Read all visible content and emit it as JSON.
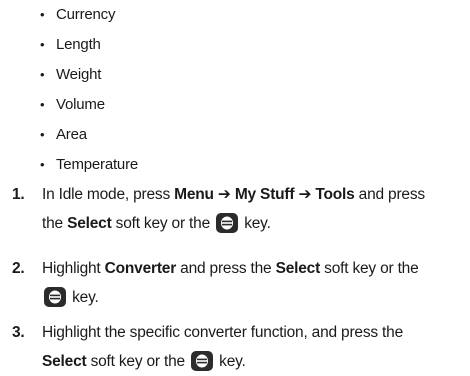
{
  "bullets": [
    "Currency",
    "Length",
    "Weight",
    "Volume",
    "Area",
    "Temperature"
  ],
  "bullet_glyph": "•",
  "steps": [
    {
      "number": "1.",
      "l1_a": "In Idle mode, press ",
      "l1_menu": "Menu",
      "arrow": "➔",
      "l1_mystuff": "My Stuff",
      "l1_tools": "Tools",
      "l1_b": " and press",
      "l2_a": "the ",
      "l2_select": "Select",
      "l2_b": " soft key or the ",
      "l2_c": " key."
    },
    {
      "number": "2.",
      "l1_a": "Highlight ",
      "l1_converter": "Converter",
      "l1_b": " and press the ",
      "l1_select": "Select",
      "l1_c": " soft key or the",
      "l2_a": " key."
    },
    {
      "number": "3.",
      "l1_a": "Highlight the specific converter function, and press the",
      "l2_select": "Select",
      "l2_b": " soft key or the ",
      "l2_c": " key."
    }
  ],
  "key_icon": "select-key-icon",
  "colors": {
    "text": "#1a1a1a",
    "key_bg": "#2b2b2b",
    "key_fg": "#ffffff"
  }
}
